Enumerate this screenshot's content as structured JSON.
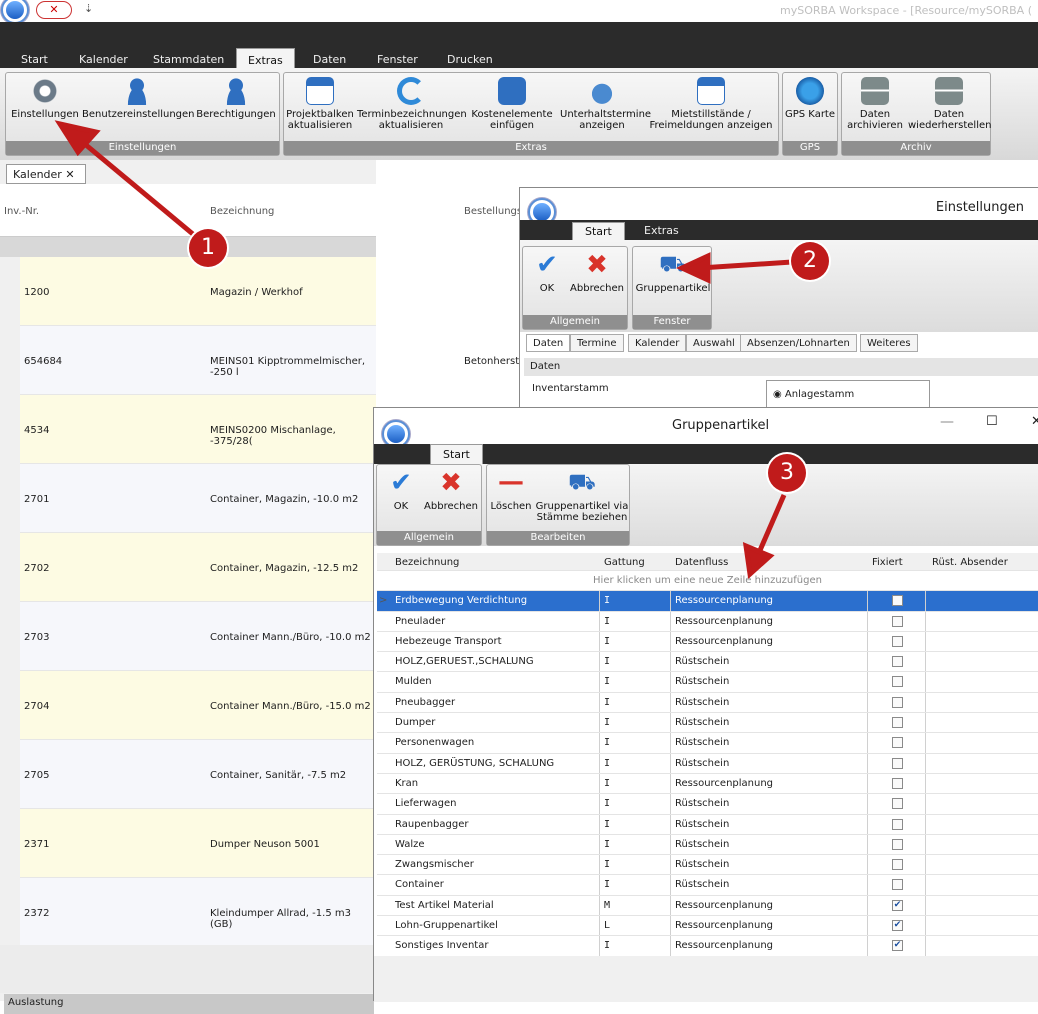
{
  "app": {
    "title": "mySORBA Workspace - [Resource/mySORBA (",
    "tabs": [
      "Start",
      "Kalender",
      "Stammdaten",
      "Extras",
      "Daten",
      "Fenster",
      "Drucken"
    ]
  },
  "ribbon": {
    "groups": [
      {
        "label": "Einstellungen",
        "buttons": [
          "Einstellungen",
          "Benutzereinstellungen",
          "Berechtigungen"
        ]
      },
      {
        "label": "Extras",
        "buttons": [
          "Projektbalken aktualisieren",
          "Terminbezeichnungen aktualisieren",
          "Kostenelemente einfügen",
          "Unterhaltstermine anzeigen",
          "Mietstillstände / Freimeldungen anzeigen"
        ]
      },
      {
        "label": "GPS",
        "buttons": [
          "GPS Karte"
        ]
      },
      {
        "label": "Archiv",
        "buttons": [
          "Daten archivieren",
          "Daten wiederherstellen"
        ]
      }
    ]
  },
  "kalender": {
    "tab": "Kalender",
    "headers": [
      "Inv.-Nr.",
      "Bezeichnung",
      "Bestellungs"
    ],
    "rows": [
      {
        "nr": "1200",
        "bez": "Magazin / Werkhof",
        "extra": ""
      },
      {
        "nr": "654684",
        "bez": "MEINS01 Kipptrommelmischer, -250 l",
        "extra": "Betonherste"
      },
      {
        "nr": "4534",
        "bez": "MEINS0200 Mischanlage, -375/28(",
        "extra": ""
      },
      {
        "nr": "2701",
        "bez": "Container, Magazin, -10.0 m2",
        "extra": ""
      },
      {
        "nr": "2702",
        "bez": "Container, Magazin, -12.5 m2",
        "extra": ""
      },
      {
        "nr": "2703",
        "bez": "Container Mann./Büro, -10.0 m2",
        "extra": ""
      },
      {
        "nr": "2704",
        "bez": "Container Mann./Büro, -15.0 m2",
        "extra": ""
      },
      {
        "nr": "2705",
        "bez": "Container, Sanitär, -7.5 m2",
        "extra": ""
      },
      {
        "nr": "2371",
        "bez": "Dumper Neuson 5001",
        "extra": ""
      },
      {
        "nr": "2372",
        "bez": "Kleindumper Allrad, -1.5 m3 (GB)",
        "extra": ""
      }
    ],
    "auslastung": "Auslastung"
  },
  "einstellungen": {
    "title": "Einstellungen",
    "tabs": [
      "Start",
      "Extras"
    ],
    "buttons": [
      "OK",
      "Abbrechen",
      "Gruppenartikel"
    ],
    "groups": [
      "Allgemein",
      "Fenster"
    ],
    "subtabs": [
      "Daten",
      "Termine",
      "Kalender",
      "Auswahl",
      "Absenzen/Lohnarten",
      "Weiteres"
    ],
    "section": "Daten",
    "field": "Inventarstamm",
    "radio": "Anlagestamm"
  },
  "gruppen": {
    "title": "Gruppenartikel",
    "tab": "Start",
    "buttons": [
      "OK",
      "Abbrechen",
      "Löschen",
      "Gruppenartikel via Stämme beziehen"
    ],
    "groups": [
      "Allgemein",
      "Bearbeiten"
    ],
    "columns": [
      "Bezeichnung",
      "Gattung",
      "Datenfluss",
      "Fixiert",
      "Rüst. Absender"
    ],
    "newrow": "Hier klicken um eine neue Zeile hinzuzufügen",
    "rows": [
      {
        "b": "Erdbewegung Verdichtung",
        "g": "I",
        "d": "Ressourcenplanung",
        "f": false
      },
      {
        "b": "Pneulader",
        "g": "I",
        "d": "Ressourcenplanung",
        "f": false
      },
      {
        "b": "Hebezeuge Transport",
        "g": "I",
        "d": "Ressourcenplanung",
        "f": false
      },
      {
        "b": "HOLZ,GERUEST.,SCHALUNG",
        "g": "I",
        "d": "Rüstschein",
        "f": false
      },
      {
        "b": "Mulden",
        "g": "I",
        "d": "Rüstschein",
        "f": false
      },
      {
        "b": "Pneubagger",
        "g": "I",
        "d": "Rüstschein",
        "f": false
      },
      {
        "b": "Dumper",
        "g": "I",
        "d": "Rüstschein",
        "f": false
      },
      {
        "b": "Personenwagen",
        "g": "I",
        "d": "Rüstschein",
        "f": false
      },
      {
        "b": "HOLZ, GERÜSTUNG, SCHALUNG",
        "g": "I",
        "d": "Rüstschein",
        "f": false
      },
      {
        "b": "Kran",
        "g": "I",
        "d": "Ressourcenplanung",
        "f": false
      },
      {
        "b": "Lieferwagen",
        "g": "I",
        "d": "Rüstschein",
        "f": false
      },
      {
        "b": "Raupenbagger",
        "g": "I",
        "d": "Rüstschein",
        "f": false
      },
      {
        "b": "Walze",
        "g": "I",
        "d": "Rüstschein",
        "f": false
      },
      {
        "b": "Zwangsmischer",
        "g": "I",
        "d": "Rüstschein",
        "f": false
      },
      {
        "b": "Container",
        "g": "I",
        "d": "Rüstschein",
        "f": false
      },
      {
        "b": "Test Artikel Material",
        "g": "M",
        "d": "Ressourcenplanung",
        "f": true
      },
      {
        "b": "Lohn-Gruppenartikel",
        "g": "L",
        "d": "Ressourcenplanung",
        "f": true
      },
      {
        "b": "Sonstiges Inventar",
        "g": "I",
        "d": "Ressourcenplanung",
        "f": true
      }
    ]
  },
  "callouts": [
    "1",
    "2",
    "3"
  ],
  "colors": {
    "accent": "#2b6fce",
    "callout": "#c01b1b",
    "dark": "#2b2b2b"
  }
}
